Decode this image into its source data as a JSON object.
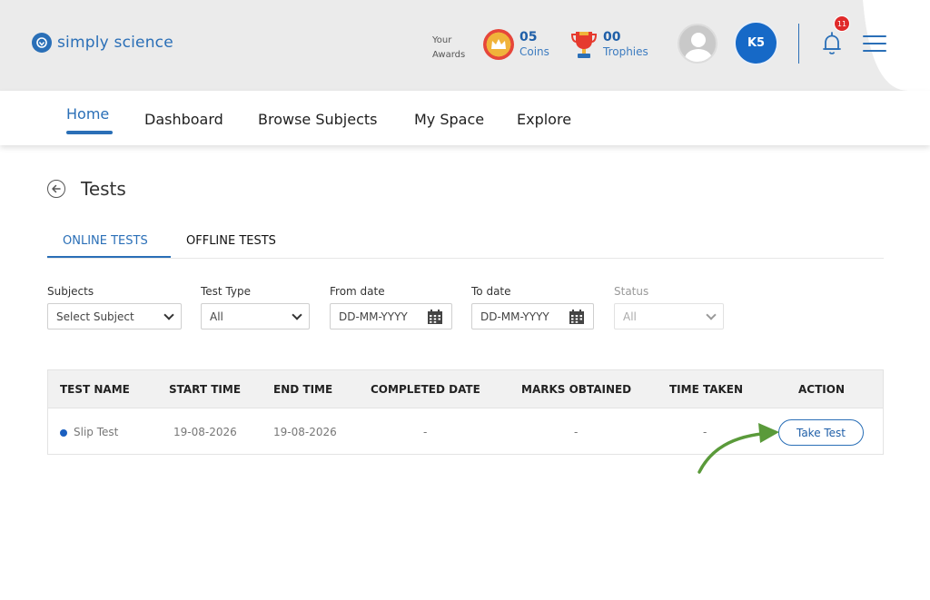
{
  "brand": {
    "name": "simply science",
    "color": "#2a6fb7"
  },
  "awards": {
    "label_line1": "Your",
    "label_line2": "Awards",
    "coins": {
      "count": "05",
      "label": "Coins",
      "icon": "crown-coin-icon"
    },
    "trophies": {
      "count": "00",
      "label": "Trophies",
      "icon": "trophy-icon"
    }
  },
  "user": {
    "initials": "K5",
    "avatar_icon": "user-avatar-icon"
  },
  "notifications": {
    "count": "11",
    "icon": "bell-icon"
  },
  "nav": {
    "items": [
      {
        "label": "Home",
        "active": true
      },
      {
        "label": "Dashboard"
      },
      {
        "label": "Browse Subjects"
      },
      {
        "label": "My Space"
      },
      {
        "label": "Explore"
      }
    ]
  },
  "page": {
    "title": "Tests",
    "back_icon": "back-arrow-icon"
  },
  "tabs": [
    {
      "label": "ONLINE TESTS",
      "active": true
    },
    {
      "label": "OFFLINE TESTS",
      "active": false
    }
  ],
  "filters": {
    "subjects": {
      "label": "Subjects",
      "value": "Select Subject"
    },
    "test_type": {
      "label": "Test Type",
      "value": "All"
    },
    "from_date": {
      "label": "From date",
      "value": "DD-MM-YYYY"
    },
    "to_date": {
      "label": "To date",
      "value": "DD-MM-YYYY"
    },
    "status": {
      "label": "Status",
      "value": "All",
      "disabled": true
    }
  },
  "table": {
    "headers": [
      "TEST NAME",
      "START TIME",
      "END TIME",
      "COMPLETED DATE",
      "MARKS OBTAINED",
      "TIME TAKEN",
      "ACTION"
    ],
    "rows": [
      {
        "test_name": "Slip Test",
        "start_time": "19-08-2026",
        "end_time": "19-08-2026",
        "completed_date": "-",
        "marks_obtained": "-",
        "time_taken": "-",
        "action": "Take Test"
      }
    ]
  },
  "colors": {
    "accent": "#2a6fb7",
    "badge": "#e02a2a",
    "arrow": "#5a9a3a"
  }
}
